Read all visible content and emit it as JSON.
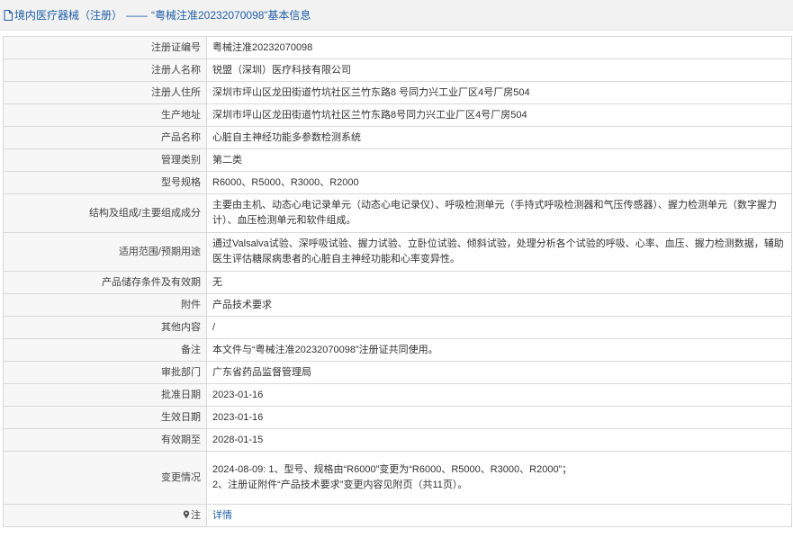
{
  "header": {
    "category": "境内医疗器械（注册）",
    "separator": "——",
    "title": "“粤械注准20232070098”基本信息"
  },
  "rows": [
    {
      "label": "注册证编号",
      "value": "粤械注准20232070098"
    },
    {
      "label": "注册人名称",
      "value": "锐盟（深圳）医疗科技有限公司"
    },
    {
      "label": "注册人住所",
      "value": "深圳市坪山区龙田街道竹坑社区兰竹东路8 号同力兴工业厂区4号厂房504"
    },
    {
      "label": "生产地址",
      "value": "深圳市坪山区龙田街道竹坑社区兰竹东路8号同力兴工业厂区4号厂房504"
    },
    {
      "label": "产品名称",
      "value": "心脏自主神经功能多参数检测系统"
    },
    {
      "label": "管理类别",
      "value": "第二类"
    },
    {
      "label": "型号规格",
      "value": "R6000、R5000、R3000、R2000"
    },
    {
      "label": "结构及组成/主要组成成分",
      "value": "主要由主机、动态心电记录单元（动态心电记录仪）、呼吸检测单元（手持式呼吸检测器和气压传感器）、握力检测单元（数字握力计）、血压检测单元和软件组成。"
    },
    {
      "label": "适用范围/预期用途",
      "value": "通过Valsalva试验、深呼吸试验、握力试验、立卧位试验、倾斜试验，处理分析各个试验的呼吸、心率、血压、握力检测数据，辅助医生评估糖尿病患者的心脏自主神经功能和心率变异性。"
    },
    {
      "label": "产品储存条件及有效期",
      "value": "无"
    },
    {
      "label": "附件",
      "value": "产品技术要求"
    },
    {
      "label": "其他内容",
      "value": "/"
    },
    {
      "label": "备注",
      "value": "本文件与“粤械注准20232070098”注册证共同使用。"
    },
    {
      "label": "审批部门",
      "value": "广东省药品监督管理局"
    },
    {
      "label": "批准日期",
      "value": "2023-01-16"
    },
    {
      "label": "生效日期",
      "value": "2023-01-16"
    },
    {
      "label": "有效期至",
      "value": "2028-01-15"
    },
    {
      "label": "变更情况",
      "value_line1": "2024-08-09: 1、型号、规格由“R6000”变更为“R6000、R5000、R3000、R2000”；",
      "value_line2": "2、注册证附件“产品技术要求”变更内容见附页（共11页）。"
    },
    {
      "label": "注",
      "value": "详情"
    }
  ],
  "colors": {
    "link": "#1f5fa8",
    "label_bg": "#f7f7f7",
    "border": "#d9d9d9",
    "header_bg": "#f2f2f2"
  },
  "icons": {
    "header": "document-icon",
    "note": "pin-icon"
  }
}
